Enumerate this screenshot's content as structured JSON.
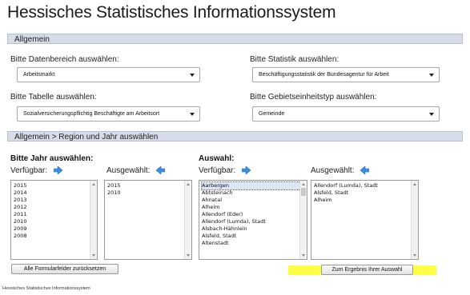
{
  "title": "Hessisches Statistisches Informationssystem",
  "general_section": {
    "heading": "Allgemein",
    "datenbereich": {
      "label": "Bitte Datenbereich auswählen:",
      "value": "Arbeitsmarkt"
    },
    "statistik": {
      "label": "Bitte Statistik auswählen:",
      "value": "Beschäftigungsstatistik der Bundesagentur für Arbeit"
    },
    "tabelle": {
      "label": "Bitte Tabelle auswählen:",
      "value": "Sozialversicherungspflichtig Beschäftigte am Arbeitsort"
    },
    "gebietseinheit": {
      "label": "Bitte Gebietseinheitstyp auswählen:",
      "value": "Gemeinde"
    }
  },
  "region_section": {
    "heading": "Allgemein > Region und Jahr auswählen",
    "year": {
      "heading": "Bitte Jahr auswählen:",
      "available_label": "Verfügbar:",
      "selected_label": "Ausgewählt:",
      "available": [
        "2015",
        "2014",
        "2013",
        "2012",
        "2011",
        "2010",
        "2009",
        "2008"
      ],
      "selected": [
        "2015",
        "2010"
      ]
    },
    "region": {
      "heading": "Auswahl:",
      "available_label": "Verfügbar:",
      "selected_label": "Ausgewählt:",
      "available": [
        "Aarbergen",
        "Abtsteinach",
        "Ahnatal",
        "Alheim",
        "Allendorf (Eder)",
        "Allendorf (Lumda), Stadt",
        "Alsbach-Hähnlein",
        "Alsfeld, Stadt",
        "Altenstadt"
      ],
      "selected": [
        "Allendorf (Lumda), Stadt",
        "Alsfeld, Stadt",
        "Alheim"
      ]
    }
  },
  "buttons": {
    "reset": "Alle Formularfelder zurücksetzen",
    "submit": "Zum Ergebnis Ihrer Auswahl"
  },
  "footer": "Hessisches Statistisches Informationssystem",
  "colors": {
    "section_bar": "#d6dce8",
    "highlight": "#ffff45",
    "arrow_icon": "#3b8fe0"
  }
}
